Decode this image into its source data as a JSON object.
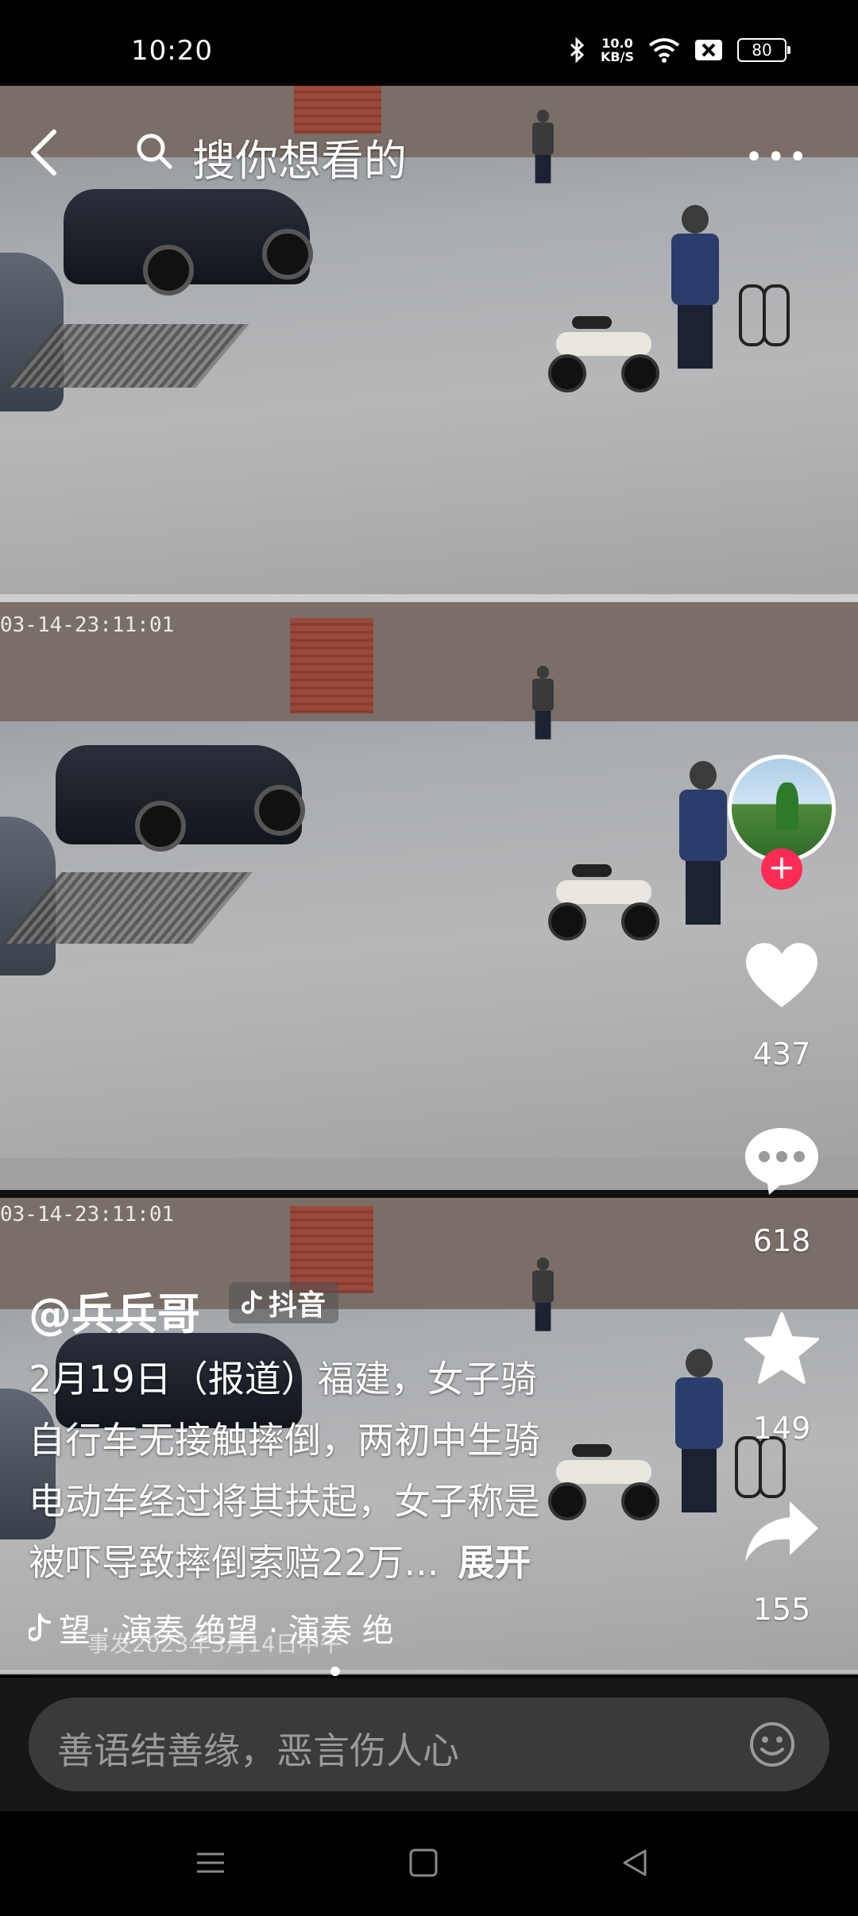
{
  "status_bar": {
    "time": "10:20",
    "net_speed_value": "10.0",
    "net_speed_unit": "KB/S",
    "battery": "80"
  },
  "search": {
    "placeholder": "搜你想看的"
  },
  "video": {
    "timestamp_1": "03-14-23:11:01",
    "timestamp_2": "03-14-23:11:01",
    "overlay_text": "事发2023年3月14日中午"
  },
  "rail": {
    "likes": "437",
    "comments": "618",
    "favorites": "149",
    "shares": "155"
  },
  "post": {
    "author": "@兵兵哥",
    "platform": "抖音",
    "caption_lines": [
      "2月19日（报道）福建，女子骑",
      "自行车无接触摔倒，两初中生骑",
      "电动车经过将其扶起，女子称是",
      "被吓导致摔倒索赔22万..."
    ],
    "expand": "展开",
    "music": "望 · 演奏   绝望 · 演奏   绝"
  },
  "comment_bar": {
    "placeholder": "善语结善缘，恶言伤人心"
  },
  "colors": {
    "accent": "#fe2c55",
    "background": "#000000",
    "comment_bar": "#161616"
  }
}
